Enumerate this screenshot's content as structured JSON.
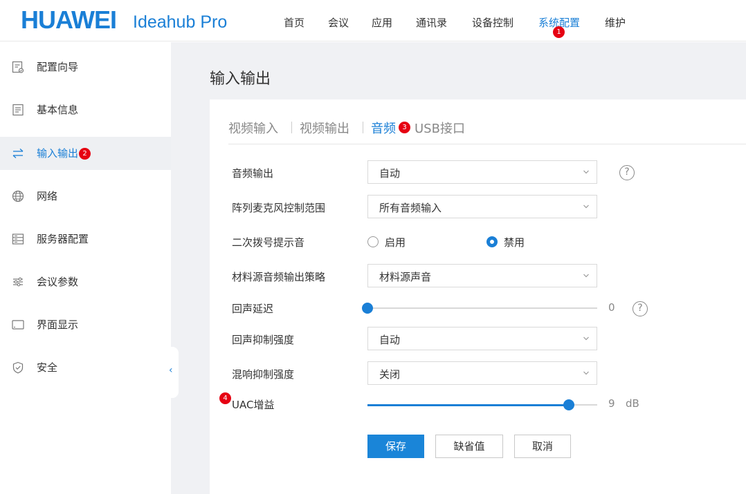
{
  "header": {
    "brand": "HUAWEI",
    "product": "Ideahub Pro",
    "nav": [
      "首页",
      "会议",
      "应用",
      "通讯录",
      "设备控制",
      "系统配置",
      "维护"
    ],
    "active_nav": "系统配置",
    "accent_color": "#1a7fd6"
  },
  "badges": [
    "1",
    "2",
    "3",
    "4"
  ],
  "sidebar": {
    "items": [
      {
        "label": "配置向导",
        "icon": "wizard-icon"
      },
      {
        "label": "基本信息",
        "icon": "document-icon"
      },
      {
        "label": "输入输出",
        "icon": "swap-icon"
      },
      {
        "label": "网络",
        "icon": "globe-icon"
      },
      {
        "label": "服务器配置",
        "icon": "server-icon"
      },
      {
        "label": "会议参数",
        "icon": "sliders-icon"
      },
      {
        "label": "界面显示",
        "icon": "display-icon"
      },
      {
        "label": "安全",
        "icon": "shield-icon"
      }
    ],
    "active": "输入输出",
    "collapse_glyph": "‹"
  },
  "main": {
    "title": "输入输出",
    "tabs": [
      "视频输入",
      "视频输出",
      "音频",
      "USB接口"
    ],
    "active_tab": "音频"
  },
  "form": {
    "audio_output": {
      "label": "音频输出",
      "value": "自动"
    },
    "mic_range": {
      "label": "阵列麦克风控制范围",
      "value": "所有音频输入"
    },
    "second_dial": {
      "label": "二次拨号提示音",
      "options": [
        "启用",
        "禁用"
      ],
      "selected": "禁用"
    },
    "material_policy": {
      "label": "材料源音频输出策略",
      "value": "材料源声音"
    },
    "echo_delay": {
      "label": "回声延迟",
      "value": "0",
      "level": 0
    },
    "echo_suppression": {
      "label": "回声抑制强度",
      "value": "自动"
    },
    "reverb_suppression": {
      "label": "混响抑制强度",
      "value": "关闭"
    },
    "uac_gain": {
      "label": "UAC增益",
      "value": "9",
      "unit": "dB",
      "level": 0.9
    },
    "help_glyph": "?"
  },
  "buttons": {
    "save": "保存",
    "default": "缺省值",
    "cancel": "取消"
  }
}
